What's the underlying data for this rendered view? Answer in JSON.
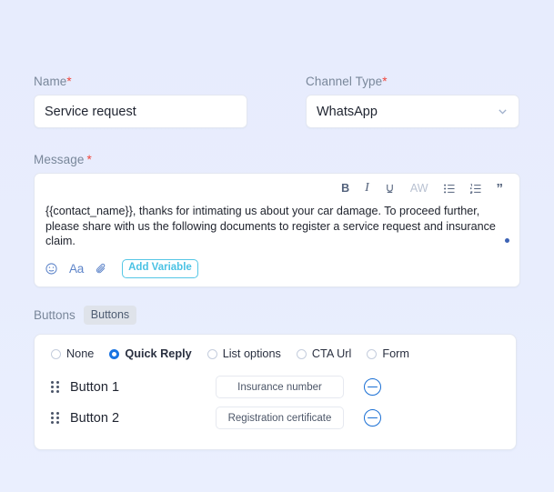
{
  "form": {
    "name_field": {
      "label": "Name",
      "required_mark": "*",
      "value": "Service request"
    },
    "channel_type_field": {
      "label": "Channel Type",
      "required_mark": "*",
      "value": "WhatsApp",
      "chevron_icon": "chevron-down-icon"
    },
    "message_field": {
      "label": "Message",
      "required_mark": "*",
      "text": "{{contact_name}}, thanks for intimating us about your car damage. To proceed further, please share with us the following documents to register a service request and insurance claim.",
      "toolbar": [
        {
          "name": "bold-icon",
          "glyph": "B"
        },
        {
          "name": "italic-icon",
          "glyph": "I"
        },
        {
          "name": "strikethrough-icon",
          "glyph": "U"
        },
        {
          "name": "clear-formatting-icon",
          "glyph": "AW"
        },
        {
          "name": "bulleted-list-icon",
          "glyph": ""
        },
        {
          "name": "numbered-list-icon",
          "glyph": ""
        },
        {
          "name": "blockquote-icon",
          "glyph": "”"
        }
      ],
      "footer": {
        "emoji_icon": "emoji-icon",
        "emoji_glyph": "☺",
        "text_format_icon": "text-format-icon",
        "text_format_glyph": "Aa",
        "attachment_icon": "attachment-icon",
        "add_variable_label": "Add Variable"
      }
    }
  },
  "buttons_section": {
    "label": "Buttons",
    "tab_label": "Buttons",
    "radio_options": [
      {
        "label": "None",
        "selected": false
      },
      {
        "label": "Quick Reply",
        "selected": true
      },
      {
        "label": "List options",
        "selected": false
      },
      {
        "label": "CTA Url",
        "selected": false
      },
      {
        "label": "Form",
        "selected": false
      }
    ],
    "rows": [
      {
        "name": "Button 1",
        "value": "Insurance number",
        "remove_icon": "minus-circle-icon"
      },
      {
        "name": "Button 2",
        "value": "Registration certificate",
        "remove_icon": "minus-circle-icon"
      }
    ]
  },
  "colors": {
    "page_background": "#e8edfd",
    "accent_blue": "#1a6fd4",
    "radio_selected": "#1a74e2",
    "add_variable": "#4ac2e4",
    "required_asterisk": "#f0463c",
    "label_gray": "#79879a"
  }
}
